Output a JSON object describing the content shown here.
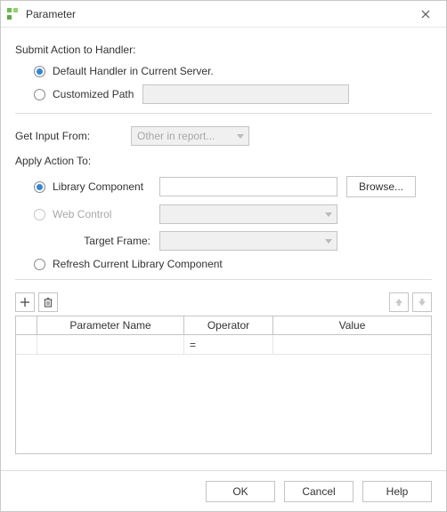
{
  "window": {
    "title": "Parameter"
  },
  "submit": {
    "label": "Submit Action to Handler:",
    "default_radio": "Default Handler in Current Server.",
    "custom_radio": "Customized Path",
    "custom_value": ""
  },
  "input_from": {
    "label": "Get Input From:",
    "value": "Other in report..."
  },
  "apply": {
    "label": "Apply Action To:",
    "library_radio": "Library Component",
    "library_value": "",
    "browse": "Browse...",
    "web_radio": "Web Control",
    "web_value": "",
    "target_frame_label": "Target Frame:",
    "target_frame_value": "",
    "refresh_radio": "Refresh Current Library Component"
  },
  "table": {
    "headers": {
      "name": "Parameter Name",
      "op": "Operator",
      "val": "Value"
    },
    "rows": [
      {
        "name": "",
        "op": "=",
        "val": ""
      }
    ]
  },
  "buttons": {
    "ok": "OK",
    "cancel": "Cancel",
    "help": "Help"
  }
}
